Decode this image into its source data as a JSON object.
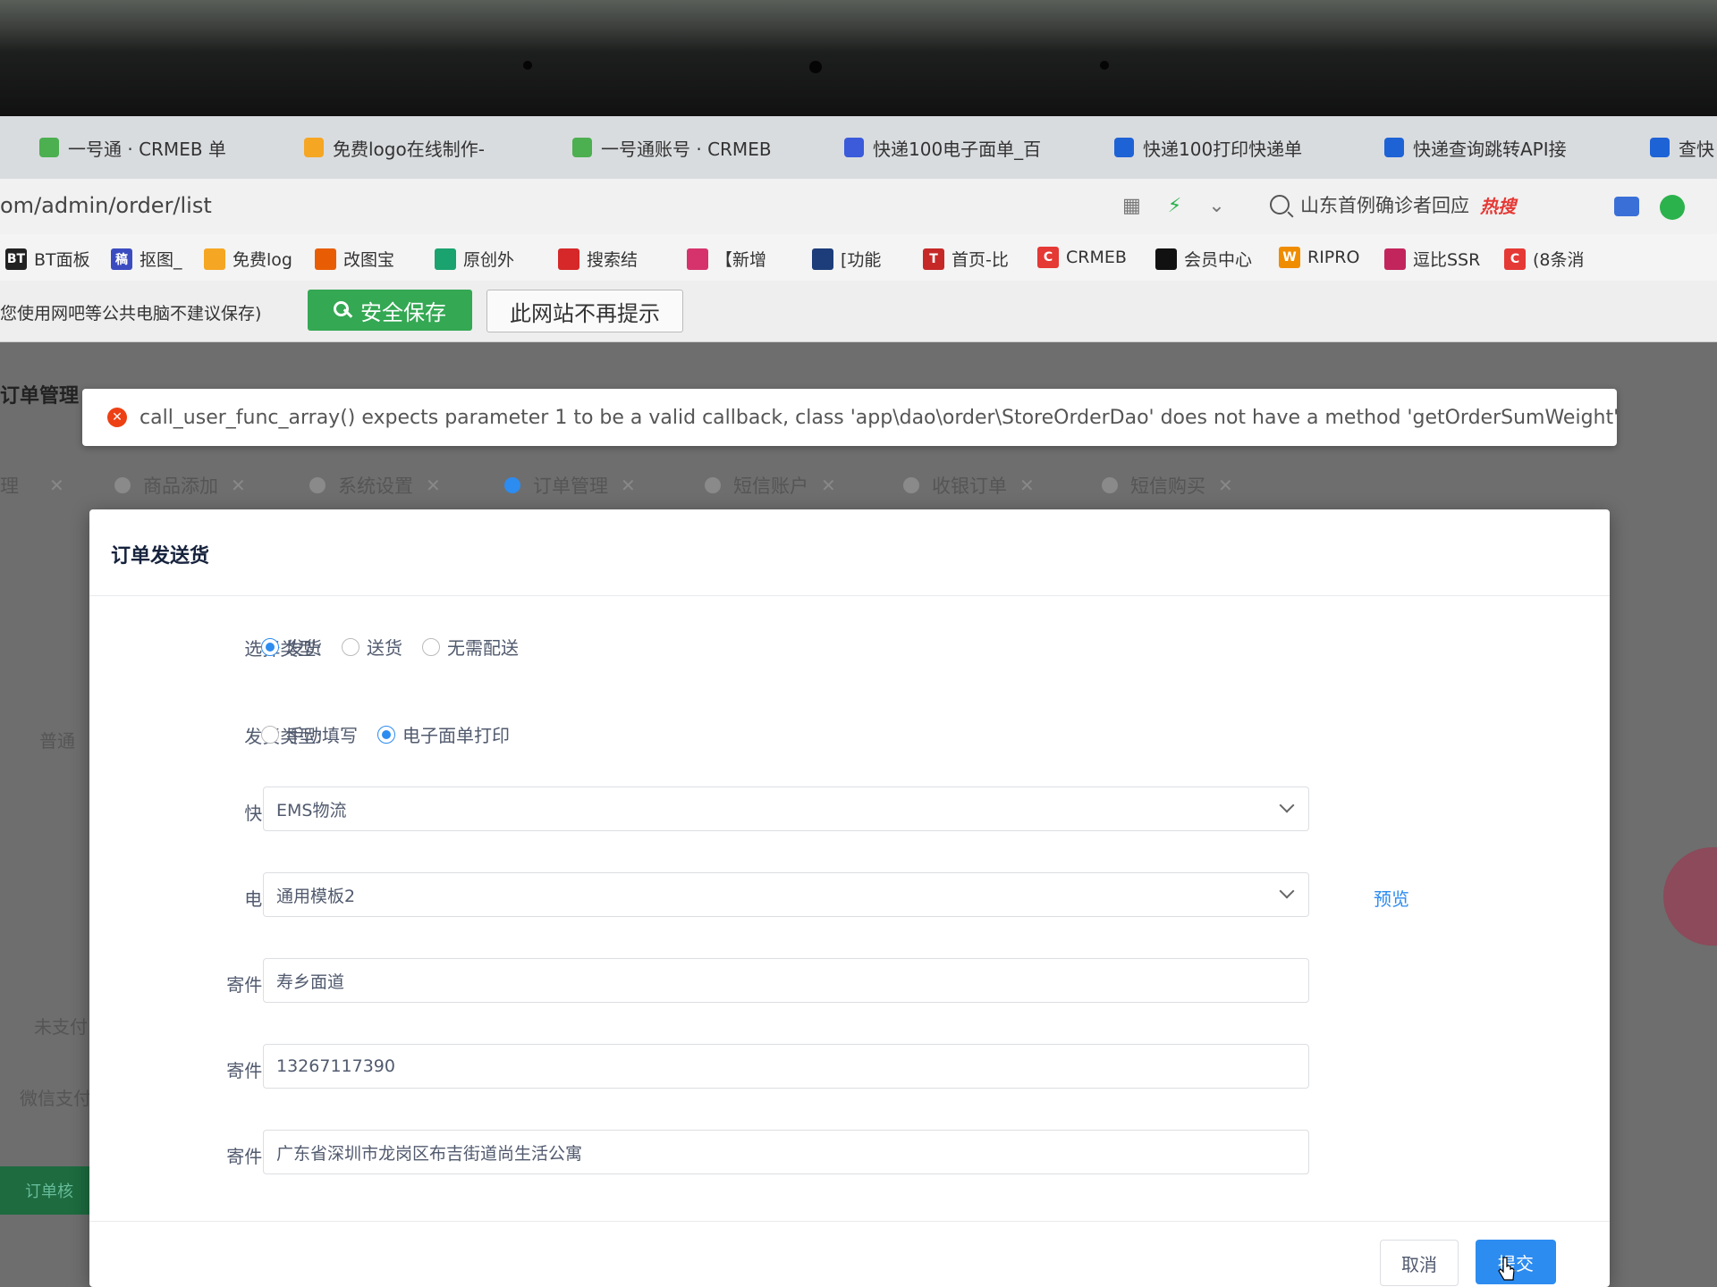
{
  "browser": {
    "tabs": [
      {
        "label": "一号通 · CRMEB 单",
        "color": "#4caf50"
      },
      {
        "label": "免费logo在线制作-",
        "color": "#f5a623"
      },
      {
        "label": "一号通账号 · CRMEB",
        "color": "#4caf50"
      },
      {
        "label": "快递100电子面单_百",
        "color": "#3b5bdb"
      },
      {
        "label": "快递100打印快递单",
        "color": "#1e63d6"
      },
      {
        "label": "快递查询跳转API接",
        "color": "#1e63d6"
      },
      {
        "label": "查快",
        "color": "#1e63d6"
      }
    ],
    "url": "om/admin/order/list",
    "search_text": "山东首例确诊者回应",
    "hot_label": "热搜",
    "bookmarks": [
      {
        "label": "BT面板",
        "icon_text": "BT",
        "color": "#222"
      },
      {
        "label": "抠图_",
        "icon_text": "稿",
        "color": "#3b4cc0"
      },
      {
        "label": "免费log",
        "icon_text": "",
        "color": "#f5a623"
      },
      {
        "label": "改图宝",
        "icon_text": "",
        "color": "#e85d04"
      },
      {
        "label": "原创外",
        "icon_text": "",
        "color": "#1aa36f"
      },
      {
        "label": "搜索结",
        "icon_text": "",
        "color": "#d62828"
      },
      {
        "label": "【新增",
        "icon_text": "",
        "color": "#d6336c"
      },
      {
        "label": "[功能",
        "icon_text": "",
        "color": "#1c3d7a"
      },
      {
        "label": "首页-比",
        "icon_text": "T",
        "color": "#c62828"
      },
      {
        "label": "CRMEB",
        "icon_text": "C",
        "color": "#e53935"
      },
      {
        "label": "会员中心",
        "icon_text": "",
        "color": "#111"
      },
      {
        "label": "RIPRO",
        "icon_text": "W",
        "color": "#f08c00"
      },
      {
        "label": "逗比SSR",
        "icon_text": "",
        "color": "#c2255c"
      },
      {
        "label": "(8条消",
        "icon_text": "C",
        "color": "#e53935"
      }
    ],
    "save_hint": "您使用网吧等公共电脑不建议保存)",
    "save_button": "安全保存",
    "never_button": "此网站不再提示"
  },
  "app": {
    "side_title": "订单管理",
    "error_message": "call_user_func_array() expects parameter 1 to be a valid callback, class 'app\\dao\\order\\StoreOrderDao' does not have a method 'getOrderSumWeight'",
    "tabs": [
      {
        "label": "理"
      },
      {
        "label": "商品添加"
      },
      {
        "label": "系统设置"
      },
      {
        "label": "订单管理"
      },
      {
        "label": "短信账户"
      },
      {
        "label": "收银订单"
      },
      {
        "label": "短信购买"
      }
    ],
    "bg_labels": [
      "普通",
      "未支付",
      "微信支付",
      "订单核"
    ]
  },
  "modal": {
    "title": "订单发送货",
    "select_type_label": "选择类型:",
    "select_type_options": [
      "发货",
      "送货",
      "无需配送"
    ],
    "ship_type_label": "发货类型:",
    "ship_type_options": [
      "手动填写",
      "电子面单打印"
    ],
    "courier_label": "快递公司:",
    "courier_value": "EMS物流",
    "waybill_label": "电子面单:",
    "waybill_value": "通用模板2",
    "preview_link": "预览",
    "sender_name_label": "寄件人姓名:",
    "sender_name_value": "寿乡面道",
    "sender_phone_label": "寄件人电话:",
    "sender_phone_value": "13267117390",
    "sender_addr_label": "寄件人地址:",
    "sender_addr_value": "广东省深圳市龙岗区布吉街道尚生活公寓",
    "cancel_button": "取消",
    "submit_button": "提交"
  }
}
